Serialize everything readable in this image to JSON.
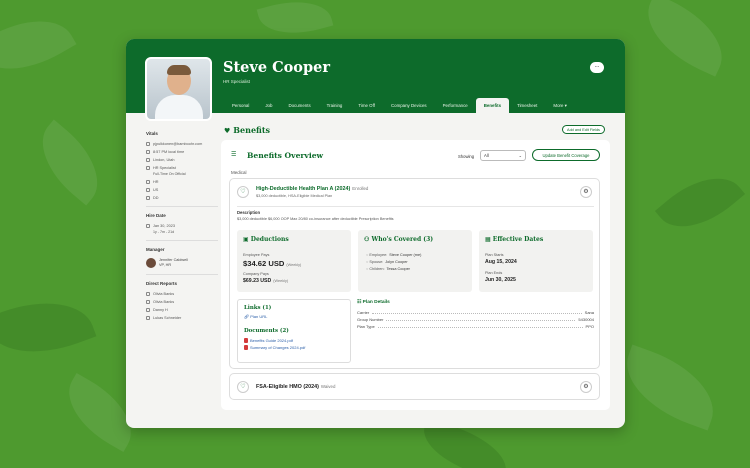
{
  "profile": {
    "name": "Steve Cooper",
    "role": "HR Specialist",
    "more_label": "..."
  },
  "tabs": [
    "Personal",
    "Job",
    "Documents",
    "Training",
    "Time Off",
    "Company Devices",
    "Performance",
    "Benefits",
    "Timesheet",
    "More ▾"
  ],
  "active_tab": "Benefits",
  "sidebar": {
    "vitals_title": "Vitals",
    "vitals": [
      {
        "icon": "mail-icon",
        "text": "pjpulkkonen@bamboohr.com"
      },
      {
        "icon": "clock-icon",
        "text": "8:57 PM local time"
      },
      {
        "icon": "location-icon",
        "text": "Lindon, Utah"
      },
      {
        "icon": "briefcase-icon",
        "text": "HR Specialist"
      }
    ],
    "vitals_sub": "Full-Time On Official",
    "vitals2": [
      {
        "icon": "department-icon",
        "text": "HR"
      },
      {
        "icon": "globe-icon",
        "text": "US"
      },
      {
        "icon": "flag-icon",
        "text": "DD"
      }
    ],
    "hire_title": "Hire Date",
    "hire_date": "Jan 30, 2023",
    "hire_duration": "1y - 7m - 21d",
    "manager_title": "Manager",
    "manager_name": "Jennifer Caldwell",
    "manager_role": "VP, HR",
    "reports_title": "Direct Reports",
    "reports": [
      "Olivia Banks",
      "Olivia Banks",
      "Danny H",
      "Lukas Schneider"
    ]
  },
  "main": {
    "title": "Benefits",
    "add_button": "Add and Edit Fields",
    "overview_title": "Benefits Overview",
    "showing_label": "Showing",
    "showing_value": "All",
    "update_button": "Update Benefit Coverage",
    "section_label": "Medical"
  },
  "plan1": {
    "name": "High-Deductible Health Plan A (2024)",
    "status": "Enrolled",
    "subtitle": "$3,000 deductible, HSA-Eligible Medical Plan",
    "desc_label": "Description",
    "description": "$3,000 deductible $6,000 OOP Max 20/80 co-insurance after deductible Prescription Benefits",
    "deductions": {
      "title": "Deductions",
      "employee_label": "Employee Pays",
      "employee_value": "$34.62 USD",
      "employee_freq": "(Weekly)",
      "company_label": "Company Pays",
      "company_value": "$69.23 USD",
      "company_freq": "(Weekly)"
    },
    "covered": {
      "title": "Who's Covered (3)",
      "rows": [
        {
          "role": "Employee:",
          "name": "Steve Cooper (me)"
        },
        {
          "role": "Spouse:",
          "name": "Jolyn Cooper"
        },
        {
          "role": "Children:",
          "name": "Tessa Cooper"
        }
      ]
    },
    "dates": {
      "title": "Effective Dates",
      "start_label": "Plan Starts",
      "start_value": "Aug 15, 2024",
      "end_label": "Plan Ends",
      "end_value": "Jun 30, 2025"
    },
    "links": {
      "title": "Links (1)",
      "items": [
        "Plan URL"
      ]
    },
    "documents": {
      "title": "Documents (2)",
      "items": [
        "Benefits Guide 2024.pdf",
        "Summary of Changes 2024.pdf"
      ]
    },
    "plan_details": {
      "title": "Plan Details",
      "rows": [
        {
          "label": "Carrier",
          "value": "Sana"
        },
        {
          "label": "Group Number",
          "value": "5430004"
        },
        {
          "label": "Plan Type",
          "value": "PPO"
        }
      ]
    }
  },
  "plan2": {
    "name": "FSA-Eligible HMO (2024)",
    "status": "Waived"
  },
  "colors": {
    "brand": "#0d6b2b",
    "background": "#4e9a2f"
  }
}
